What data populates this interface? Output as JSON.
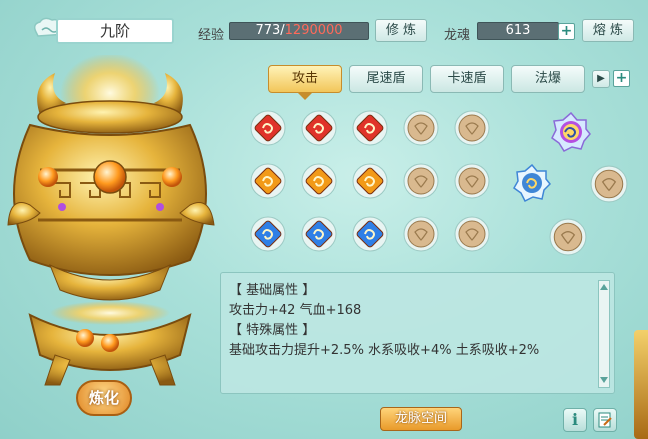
{
  "header": {
    "realm_title": "九阶",
    "exp_label": "经验",
    "exp_current": "773",
    "exp_separator": "/",
    "exp_max": "1290000",
    "cultivate_button": "修 炼",
    "dragon_soul_label": "龙魂",
    "dragon_soul_value": "613",
    "plus_symbol": "+",
    "smelt_button": "熔 炼"
  },
  "tabs": [
    {
      "label": "攻击",
      "active": true
    },
    {
      "label": "尾速盾",
      "active": false
    },
    {
      "label": "卡速盾",
      "active": false
    },
    {
      "label": "法爆",
      "active": false
    }
  ],
  "tab_controls": {
    "next_symbol": "▶",
    "add_symbol": "+"
  },
  "gem_grid": {
    "rows": [
      {
        "color": "red",
        "filled": 3,
        "empty": 2
      },
      {
        "color": "orange",
        "filled": 3,
        "empty": 2
      },
      {
        "color": "blue",
        "filled": 3,
        "empty": 2
      }
    ],
    "colors": {
      "red": "#e0332a",
      "orange": "#f29a18",
      "blue": "#2f7fe6",
      "slot": "#d9b98f"
    }
  },
  "info_panel": {
    "base_header": "【 基础属性 】",
    "base_values": "攻击力+42 气血+168",
    "special_header": "【 特殊属性 】",
    "special_values": "基础攻击力提升+2.5% 水系吸收+4% 土系吸收+2%"
  },
  "footer": {
    "dragon_space_button": "龙脉空间",
    "info_icon_symbol": "i",
    "refine_button": "炼化"
  },
  "colors": {
    "accent_gold": "#f2c65a",
    "exp_current_color": "#ffffff",
    "exp_max_color": "#ff6a5a",
    "panel_bg": "#bce6e2"
  }
}
